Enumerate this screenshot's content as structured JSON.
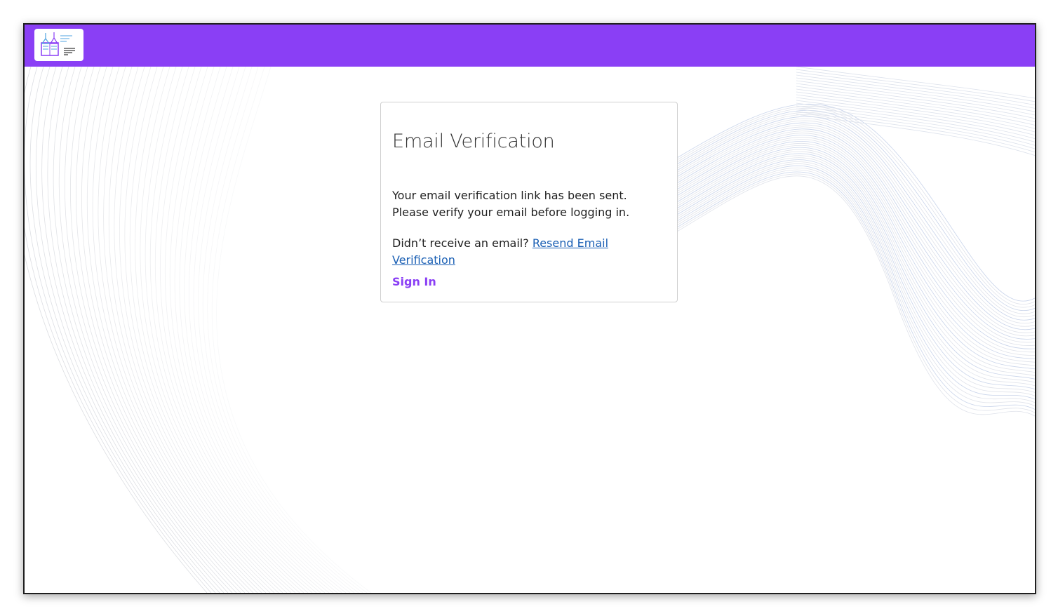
{
  "header": {
    "logo_icon": "book-flask-logo",
    "brand_color": "#8a3ff5"
  },
  "card": {
    "title": "Email Verification",
    "message": "Your email verification link has been sent. Please verify your email before logging in.",
    "resend_prompt": "Didn’t receive an email?",
    "resend_link": "Resend Email Verification",
    "sign_in": "Sign In"
  },
  "colors": {
    "link": "#1a5fb4",
    "card_border": "#cfcfcf"
  }
}
